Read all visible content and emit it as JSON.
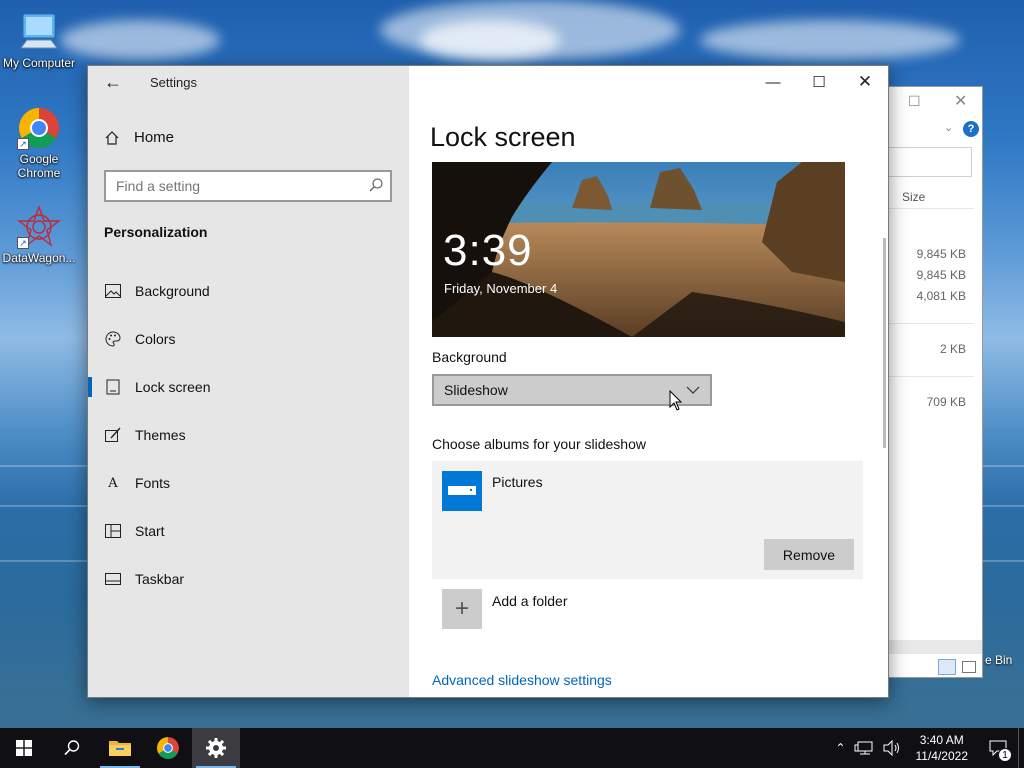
{
  "desktop": {
    "icons": [
      {
        "label": "My Computer"
      },
      {
        "label": "Google Chrome"
      },
      {
        "label": "DataWagon..."
      }
    ],
    "recycle_fragment": "e Bin"
  },
  "explorer": {
    "size_header": "Size",
    "sizes": [
      "9,845 KB",
      "9,845 KB",
      "4,081 KB",
      "2 KB",
      "709 KB"
    ]
  },
  "settings": {
    "app_title": "Settings",
    "home_label": "Home",
    "search_placeholder": "Find a setting",
    "section_title": "Personalization",
    "nav": [
      {
        "label": "Background",
        "icon": "picture-icon"
      },
      {
        "label": "Colors",
        "icon": "palette-icon"
      },
      {
        "label": "Lock screen",
        "icon": "lock-screen-icon",
        "active": true
      },
      {
        "label": "Themes",
        "icon": "themes-icon"
      },
      {
        "label": "Fonts",
        "icon": "fonts-icon"
      },
      {
        "label": "Start",
        "icon": "start-icon"
      },
      {
        "label": "Taskbar",
        "icon": "taskbar-icon"
      }
    ],
    "page_title": "Lock screen",
    "preview": {
      "time": "3:39",
      "date": "Friday, November 4"
    },
    "background_label": "Background",
    "background_value": "Slideshow",
    "albums_label": "Choose albums for your slideshow",
    "album_name": "Pictures",
    "remove_label": "Remove",
    "add_folder_label": "Add a folder",
    "advanced_link": "Advanced slideshow settings"
  },
  "taskbar": {
    "time": "3:40 AM",
    "date": "11/4/2022",
    "notification_count": "1"
  },
  "colors": {
    "accent": "#0078d7",
    "link": "#0067b8",
    "taskbar": "#101014"
  }
}
